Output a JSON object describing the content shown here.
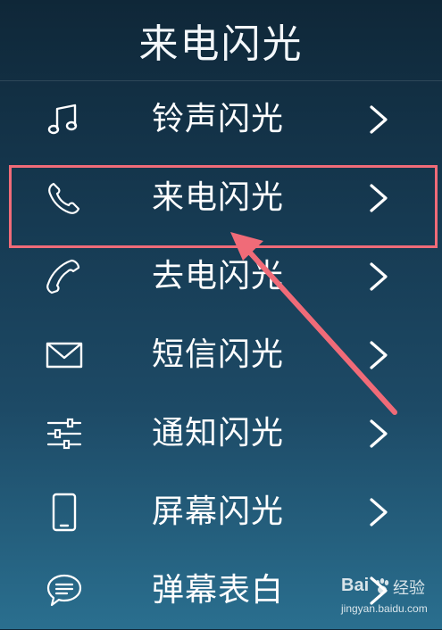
{
  "header": {
    "title": "来电闪光"
  },
  "menu": {
    "items": [
      {
        "label": "铃声闪光",
        "icon": "music-note-icon"
      },
      {
        "label": "来电闪光",
        "icon": "incoming-call-icon",
        "highlighted": true
      },
      {
        "label": "去电闪光",
        "icon": "outgoing-call-icon"
      },
      {
        "label": "短信闪光",
        "icon": "envelope-icon"
      },
      {
        "label": "通知闪光",
        "icon": "sliders-icon"
      },
      {
        "label": "屏幕闪光",
        "icon": "smartphone-icon"
      },
      {
        "label": "弹幕表白",
        "icon": "chat-bubble-icon"
      }
    ]
  },
  "annotation": {
    "color": "#f06b78"
  },
  "watermark": {
    "logo": "Bai",
    "brand": "经验",
    "url": "jingyan.baidu.com"
  }
}
